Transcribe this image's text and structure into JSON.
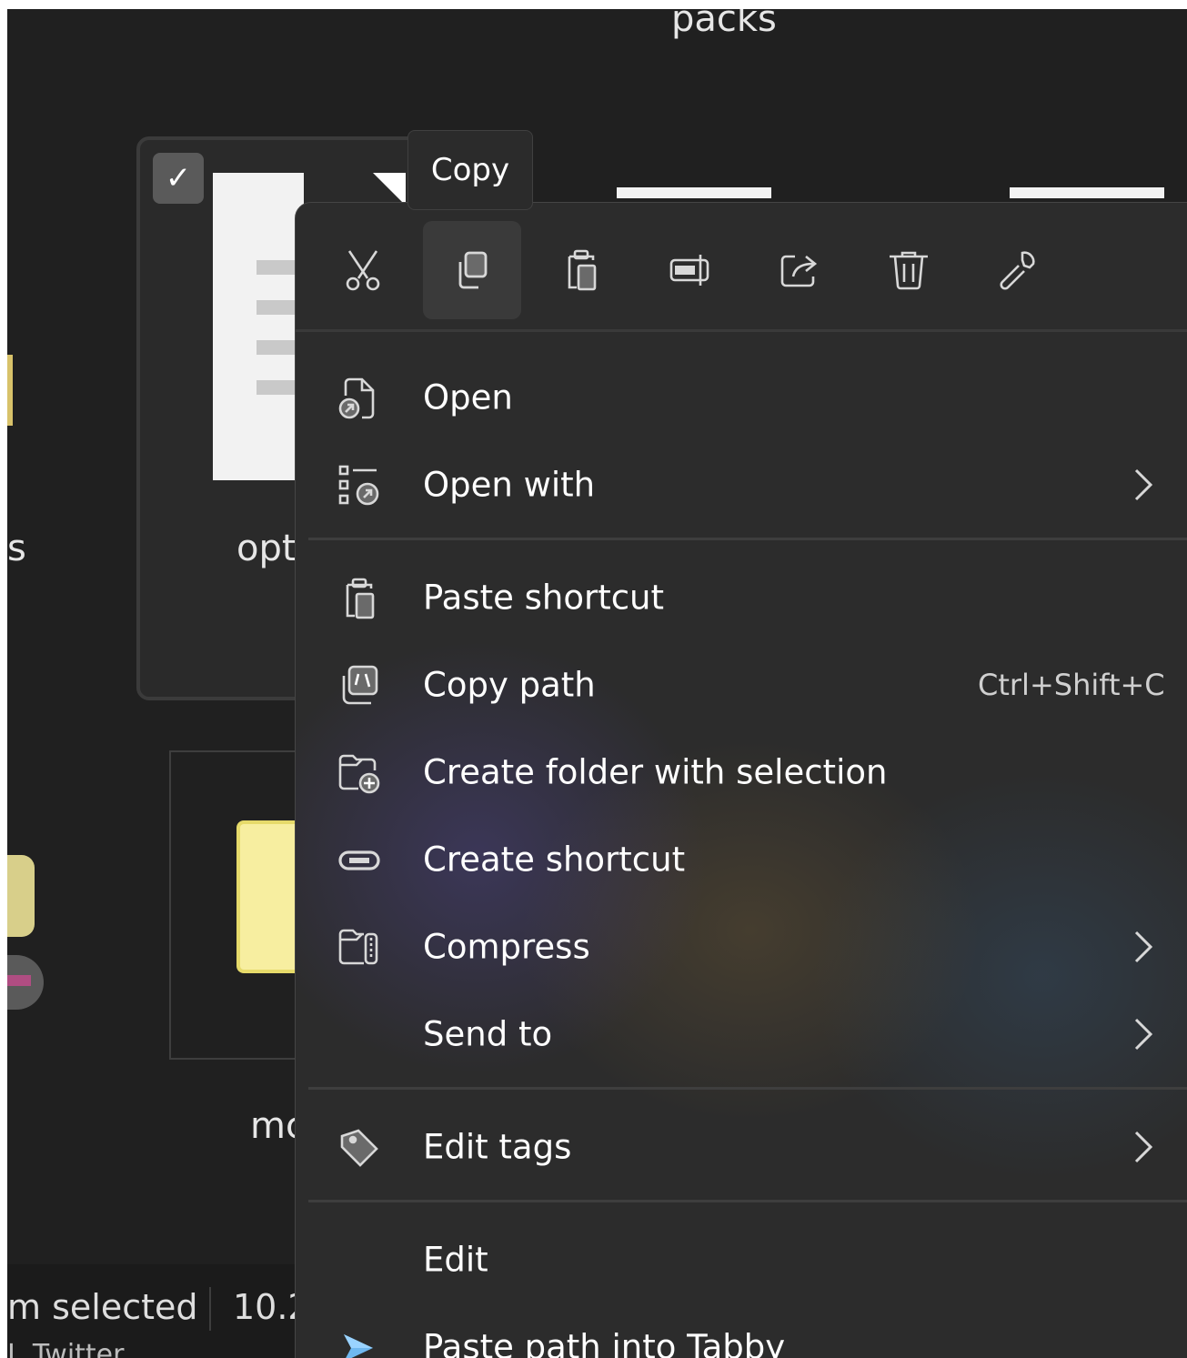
{
  "background": {
    "folder_title": "packs",
    "file_label": "opt",
    "left_edge_label": "s",
    "second_file_label": "mc",
    "status_selected": "m selected",
    "status_size": "10.2",
    "status_below": "I. Twitter"
  },
  "tooltip": {
    "text": "Copy"
  },
  "toolbar": [
    {
      "name": "cut",
      "icon": "scissors-icon"
    },
    {
      "name": "copy",
      "icon": "copy-icon",
      "hover": true
    },
    {
      "name": "paste",
      "icon": "clipboard-icon"
    },
    {
      "name": "rename",
      "icon": "rename-icon"
    },
    {
      "name": "share",
      "icon": "share-icon"
    },
    {
      "name": "delete",
      "icon": "trash-icon"
    },
    {
      "name": "properties",
      "icon": "wrench-icon"
    }
  ],
  "menu": {
    "open": {
      "label": "Open",
      "icon": "open-file-icon"
    },
    "open_with": {
      "label": "Open with",
      "icon": "open-with-icon",
      "submenu": true
    },
    "paste_shortcut": {
      "label": "Paste shortcut",
      "icon": "paste-shortcut-icon"
    },
    "copy_path": {
      "label": "Copy path",
      "shortcut": "Ctrl+Shift+C",
      "icon": "copy-path-icon"
    },
    "create_folder": {
      "label": "Create folder with selection",
      "icon": "new-folder-icon"
    },
    "create_shortcut": {
      "label": "Create shortcut",
      "icon": "link-icon"
    },
    "compress": {
      "label": "Compress",
      "icon": "zip-folder-icon",
      "submenu": true
    },
    "send_to": {
      "label": "Send to",
      "submenu": true
    },
    "edit_tags": {
      "label": "Edit tags",
      "icon": "tag-icon",
      "submenu": true
    },
    "edit": {
      "label": "Edit"
    },
    "paste_tabby": {
      "label": "Paste path into Tabby",
      "icon": "tabby-icon"
    }
  },
  "colors": {
    "window_bg": "#202020",
    "menu_bg": "#2c2c2c",
    "text": "#ffffff",
    "tabby_accent": "#6fb8f0"
  }
}
